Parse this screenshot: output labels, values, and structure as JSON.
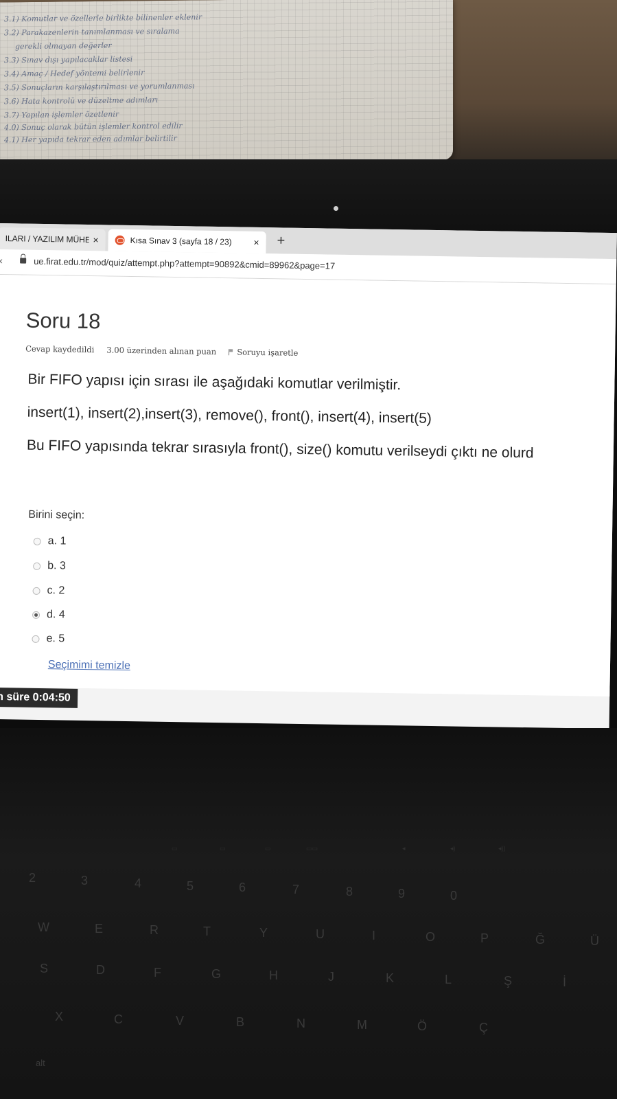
{
  "browser": {
    "tabs": [
      {
        "label": "ILARI / YAZILIM MÜHEN",
        "close": "×"
      },
      {
        "label": "Kısa Sınav 3 (sayfa 18 / 23)",
        "close": "×"
      }
    ],
    "new_tab": "+",
    "url": "ue.firat.edu.tr/mod/quiz/attempt.php?attempt=90892&cmid=89962&page=17"
  },
  "question": {
    "title": "Soru 18",
    "status": "Cevap kaydedildi",
    "points": "3.00 üzerinden alınan puan",
    "flag_label": "Soruyu işaretle",
    "line1": "Bir FIFO yapısı için sırası ile aşağıdaki komutlar verilmiştir.",
    "line2": "insert(1), insert(2),insert(3), remove(), front(), insert(4), insert(5)",
    "line3": "Bu FIFO yapısında tekrar sırasıyla front(), size()  komutu verilseydi çıktı ne olurd"
  },
  "answer": {
    "prompt": "Birini seçin:",
    "options": [
      {
        "label": "a. 1",
        "selected": false
      },
      {
        "label": "b. 3",
        "selected": false
      },
      {
        "label": "c. 2",
        "selected": false
      },
      {
        "label": "d. 4",
        "selected": true
      },
      {
        "label": "e. 5",
        "selected": false
      }
    ],
    "clear_label": "Seçimimi temizle"
  },
  "timer": {
    "label": "n süre",
    "value": "0:04:50"
  },
  "notes": [
    "3.1) Komutlar ve özellerle birlikte bilinenler eklenir",
    "3.2) Parakazenlerin tanımlanması ve sıralama",
    "gerekli olmayan değerler",
    "3.3) Sınav dışı yapılacaklar listesi",
    "3.4) Amaç / Hedef yöntemi belirlenir",
    "3.5) Sonuçların karşılaştırılması ve yorumlanması",
    "3.6) Hata kontrolü ve düzeltme adımları",
    "3.7) Yapılan işlemler özetlenir",
    "4.0) Sonuç olarak bütün işlemler kontrol edilir",
    "4.1) Her yapıda tekrar eden adımlar belirtilir"
  ],
  "keyboard": {
    "row1": [
      "2",
      "3",
      "4",
      "5",
      "6",
      "7",
      "8",
      "9",
      "0"
    ],
    "row2": [
      "W",
      "E",
      "R",
      "T",
      "Y",
      "U",
      "I",
      "O",
      "P",
      "Ğ",
      "Ü"
    ],
    "row3": [
      "S",
      "D",
      "F",
      "G",
      "H",
      "J",
      "K",
      "L",
      "Ş",
      "İ"
    ],
    "row4": [
      "X",
      "C",
      "V",
      "B",
      "N",
      "M",
      "Ö",
      "Ç"
    ],
    "alt": "alt"
  }
}
